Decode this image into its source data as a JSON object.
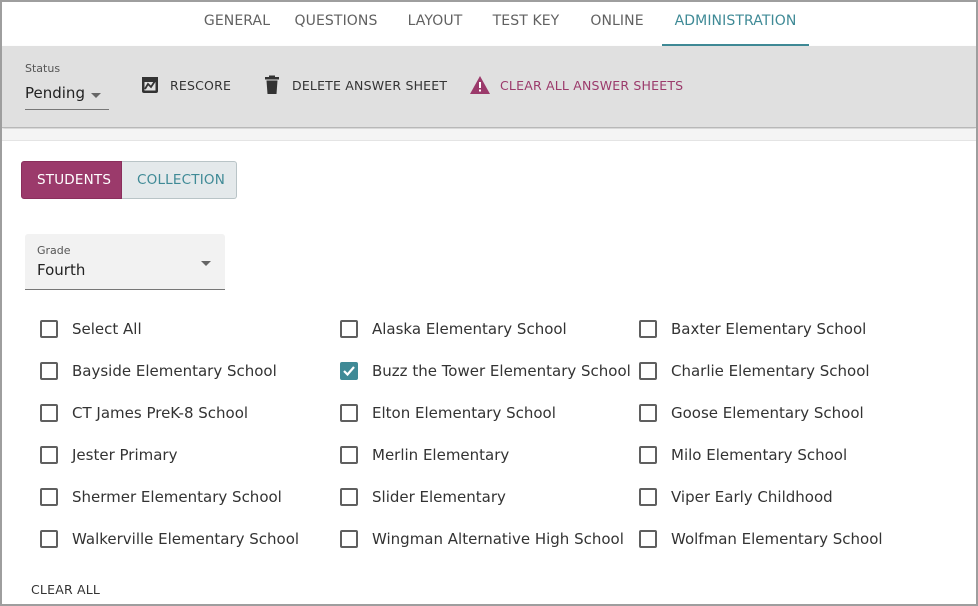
{
  "tabs": [
    {
      "label": "GENERAL",
      "active": false
    },
    {
      "label": "QUESTIONS",
      "active": false
    },
    {
      "label": "LAYOUT",
      "active": false
    },
    {
      "label": "TEST KEY",
      "active": false
    },
    {
      "label": "ONLINE",
      "active": false
    },
    {
      "label": "ADMINISTRATION",
      "active": true
    }
  ],
  "toolbar": {
    "status_label": "Status",
    "status_value": "Pending",
    "rescore_label": "RESCORE",
    "delete_label": "DELETE ANSWER SHEET",
    "clear_all_label": "CLEAR ALL ANSWER SHEETS",
    "icons": {
      "rescore": "rescore-icon",
      "delete": "trash-icon",
      "clear_all": "warning-icon"
    }
  },
  "view_toggle": {
    "students_label": "STUDENTS",
    "collection_label": "COLLECTION",
    "selected": "STUDENTS"
  },
  "grade": {
    "label": "Grade",
    "value": "Fourth"
  },
  "schools": [
    {
      "label": "Select All",
      "checked": false
    },
    {
      "label": "Alaska Elementary School",
      "checked": false
    },
    {
      "label": "Baxter Elementary School",
      "checked": false
    },
    {
      "label": "Bayside Elementary School",
      "checked": false
    },
    {
      "label": "Buzz the Tower Elementary School",
      "checked": true
    },
    {
      "label": "Charlie Elementary School",
      "checked": false
    },
    {
      "label": "CT James PreK-8 School",
      "checked": false
    },
    {
      "label": "Elton Elementary School",
      "checked": false
    },
    {
      "label": "Goose Elementary School",
      "checked": false
    },
    {
      "label": "Jester Primary",
      "checked": false
    },
    {
      "label": "Merlin Elementary",
      "checked": false
    },
    {
      "label": "Milo Elementary School",
      "checked": false
    },
    {
      "label": "Shermer Elementary School",
      "checked": false
    },
    {
      "label": "Slider Elementary",
      "checked": false
    },
    {
      "label": "Viper Early Childhood",
      "checked": false
    },
    {
      "label": "Walkerville Elementary School",
      "checked": false
    },
    {
      "label": "Wingman Alternative High School",
      "checked": false
    },
    {
      "label": "Wolfman Elementary School",
      "checked": false
    }
  ],
  "footer": {
    "clear_all_label": "CLEAR ALL"
  },
  "colors": {
    "accent_teal": "#3f8a96",
    "accent_magenta": "#9b3a6b",
    "toolbar_bg": "#e0e0e0"
  }
}
